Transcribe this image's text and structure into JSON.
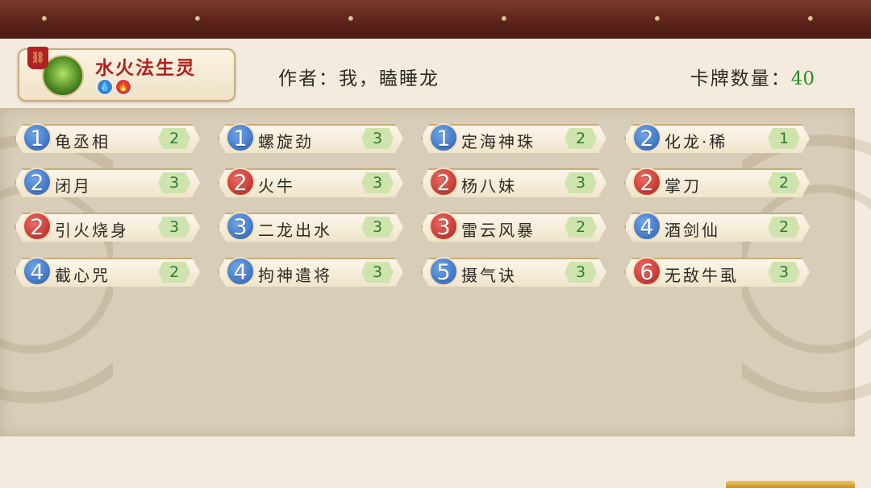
{
  "deck": {
    "name": "水火法生灵",
    "elements": [
      "water-icon",
      "fire-icon"
    ],
    "author_label": "作者：",
    "author_name": "我，瞌睡龙",
    "count_label": "卡牌数量：",
    "count_value": "40"
  },
  "colors": {
    "cost_blue": "#2a5eb3",
    "cost_red": "#b0221c",
    "qty_green": "#2f7a2f",
    "deck_name": "#b01f1f"
  },
  "cards": [
    {
      "cost": "1",
      "color": "blue",
      "name": "龟丞相",
      "qty": "2"
    },
    {
      "cost": "1",
      "color": "blue",
      "name": "螺旋劲",
      "qty": "3"
    },
    {
      "cost": "1",
      "color": "blue",
      "name": "定海神珠",
      "qty": "2"
    },
    {
      "cost": "2",
      "color": "blue",
      "name": "化龙·稀",
      "qty": "1"
    },
    {
      "cost": "2",
      "color": "blue",
      "name": "闭月",
      "qty": "3"
    },
    {
      "cost": "2",
      "color": "red",
      "name": "火牛",
      "qty": "3"
    },
    {
      "cost": "2",
      "color": "red",
      "name": "杨八妹",
      "qty": "3"
    },
    {
      "cost": "2",
      "color": "red",
      "name": "掌刀",
      "qty": "2"
    },
    {
      "cost": "2",
      "color": "red",
      "name": "引火烧身",
      "qty": "3"
    },
    {
      "cost": "3",
      "color": "blue",
      "name": "二龙出水",
      "qty": "3"
    },
    {
      "cost": "3",
      "color": "red",
      "name": "雷云风暴",
      "qty": "2"
    },
    {
      "cost": "4",
      "color": "blue",
      "name": "酒剑仙",
      "qty": "2"
    },
    {
      "cost": "4",
      "color": "blue",
      "name": "截心咒",
      "qty": "2"
    },
    {
      "cost": "4",
      "color": "blue",
      "name": "拘神遣将",
      "qty": "3"
    },
    {
      "cost": "5",
      "color": "blue",
      "name": "摄气诀",
      "qty": "3"
    },
    {
      "cost": "6",
      "color": "red",
      "name": "无敌牛虱",
      "qty": "3"
    }
  ]
}
